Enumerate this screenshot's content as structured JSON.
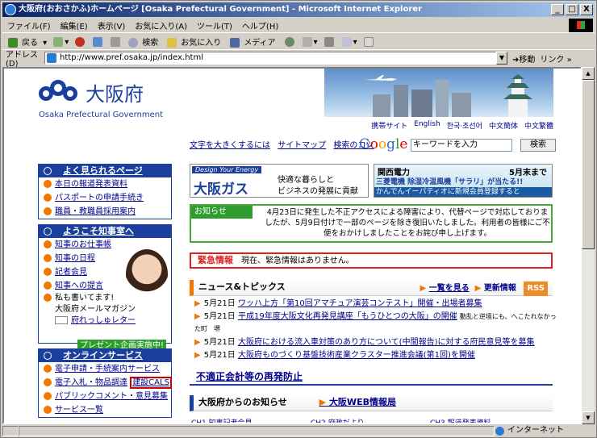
{
  "window": {
    "title": "大阪府(おおさかふ)ホームページ [Osaka Prefectural Government] - Microsoft Internet Explorer",
    "min": "_",
    "max": "□",
    "close": "X"
  },
  "menu": [
    "ファイル(F)",
    "編集(E)",
    "表示(V)",
    "お気に入り(A)",
    "ツール(T)",
    "ヘルプ(H)"
  ],
  "toolbar": {
    "back": "戻る",
    "search": "検索",
    "favorites": "お気に入り",
    "media": "メディア"
  },
  "address": {
    "label": "アドレス(D)",
    "url": "http://www.pref.osaka.jp/index.html",
    "go": "移動",
    "links": "リンク »"
  },
  "header": {
    "logo": "大阪府",
    "logo_en": "Osaka Prefectural Government",
    "links": [
      "携帯サイト",
      "English",
      "한국·조선어",
      "中文簡体",
      "中文繁體"
    ]
  },
  "search": {
    "links": [
      "文字を大きくするには",
      "サイトマップ",
      "検索のコツ"
    ],
    "google": "Google",
    "placeholder": "キーワードを入力",
    "button": "検索"
  },
  "popular": {
    "title": "よく見られるページ",
    "items": [
      "本日の報道発表資料",
      "パスポートの申請手続き",
      "職員・教職員採用案内"
    ]
  },
  "governor": {
    "title": "ようこそ知事室へ",
    "items": [
      "知事のお仕事帳",
      "知事の日程",
      "記者会見",
      "知事への提言"
    ],
    "write": "私も書いてます!",
    "magazine": "大阪府メールマガジン",
    "letter": "府れっしゅレター",
    "present": "プレゼント企画実施中!"
  },
  "online": {
    "title": "オンラインサービス",
    "items": [
      "電子申請・手続案内サービス",
      "電子入札・物品調達",
      "パブリックコメント・意見募集",
      "サービス一覧"
    ],
    "cals": "建設CALS"
  },
  "banners": {
    "gas_tagline": "Design Your Energy",
    "gas_name": "大阪ガス",
    "gas_copy1": "快適な暮らしと",
    "gas_copy2": "ビジネスの発展に貢献",
    "kepco_name": "関西電力",
    "kepco_until": "5月末まで",
    "kepco_product": "三菱電機 除湿冷温風機「サラリ」が当たる!!",
    "kepco_cta": "かんでんイーパティオに新規会員登録すると"
  },
  "notice": {
    "tag": "お知らせ",
    "text": "4月23日に発生した不正アクセスによる障害により、代替ページで対応しておりましたが、5月9日付けで一部のページを除き復旧いたしました。利用者の皆様にご不便をおかけしましたことをお詫び申し上げます。"
  },
  "emergency": {
    "label": "緊急情報",
    "text": "現在、緊急情報はありません。"
  },
  "news": {
    "title": "ニュース&トピックス",
    "see_all": "一覧を見る",
    "updates": "更新情報",
    "rss": "RSS",
    "items": [
      {
        "date": "5月21日",
        "text": "ワッハ上方「第10回アマチュア演芸コンテスト」開催・出場者募集",
        "extra": ""
      },
      {
        "date": "5月21日",
        "text": "平成19年度大阪文化再発見講座「もうひとつの大阪」の開催",
        "extra": "動乱と逆境にも、へこたれなかった町　堺"
      },
      {
        "date": "5月21日",
        "text": "大阪府における流入車対策のあり方について(中間報告)に対する府民意見等を募集",
        "extra": ""
      },
      {
        "date": "5月21日",
        "text": "大阪府ものづくり基盤技術産業クラスター推進会議(第1回)を開催",
        "extra": ""
      }
    ]
  },
  "improper": "不適正会計等の再発防止",
  "info": {
    "title": "大阪府からのお知らせ",
    "web": "大阪WEB情報局",
    "channels": [
      "CH1 知事記者会見",
      "CH2 府政だより",
      "CH3 報道発表資料"
    ]
  },
  "status": {
    "zone": "インターネット"
  }
}
